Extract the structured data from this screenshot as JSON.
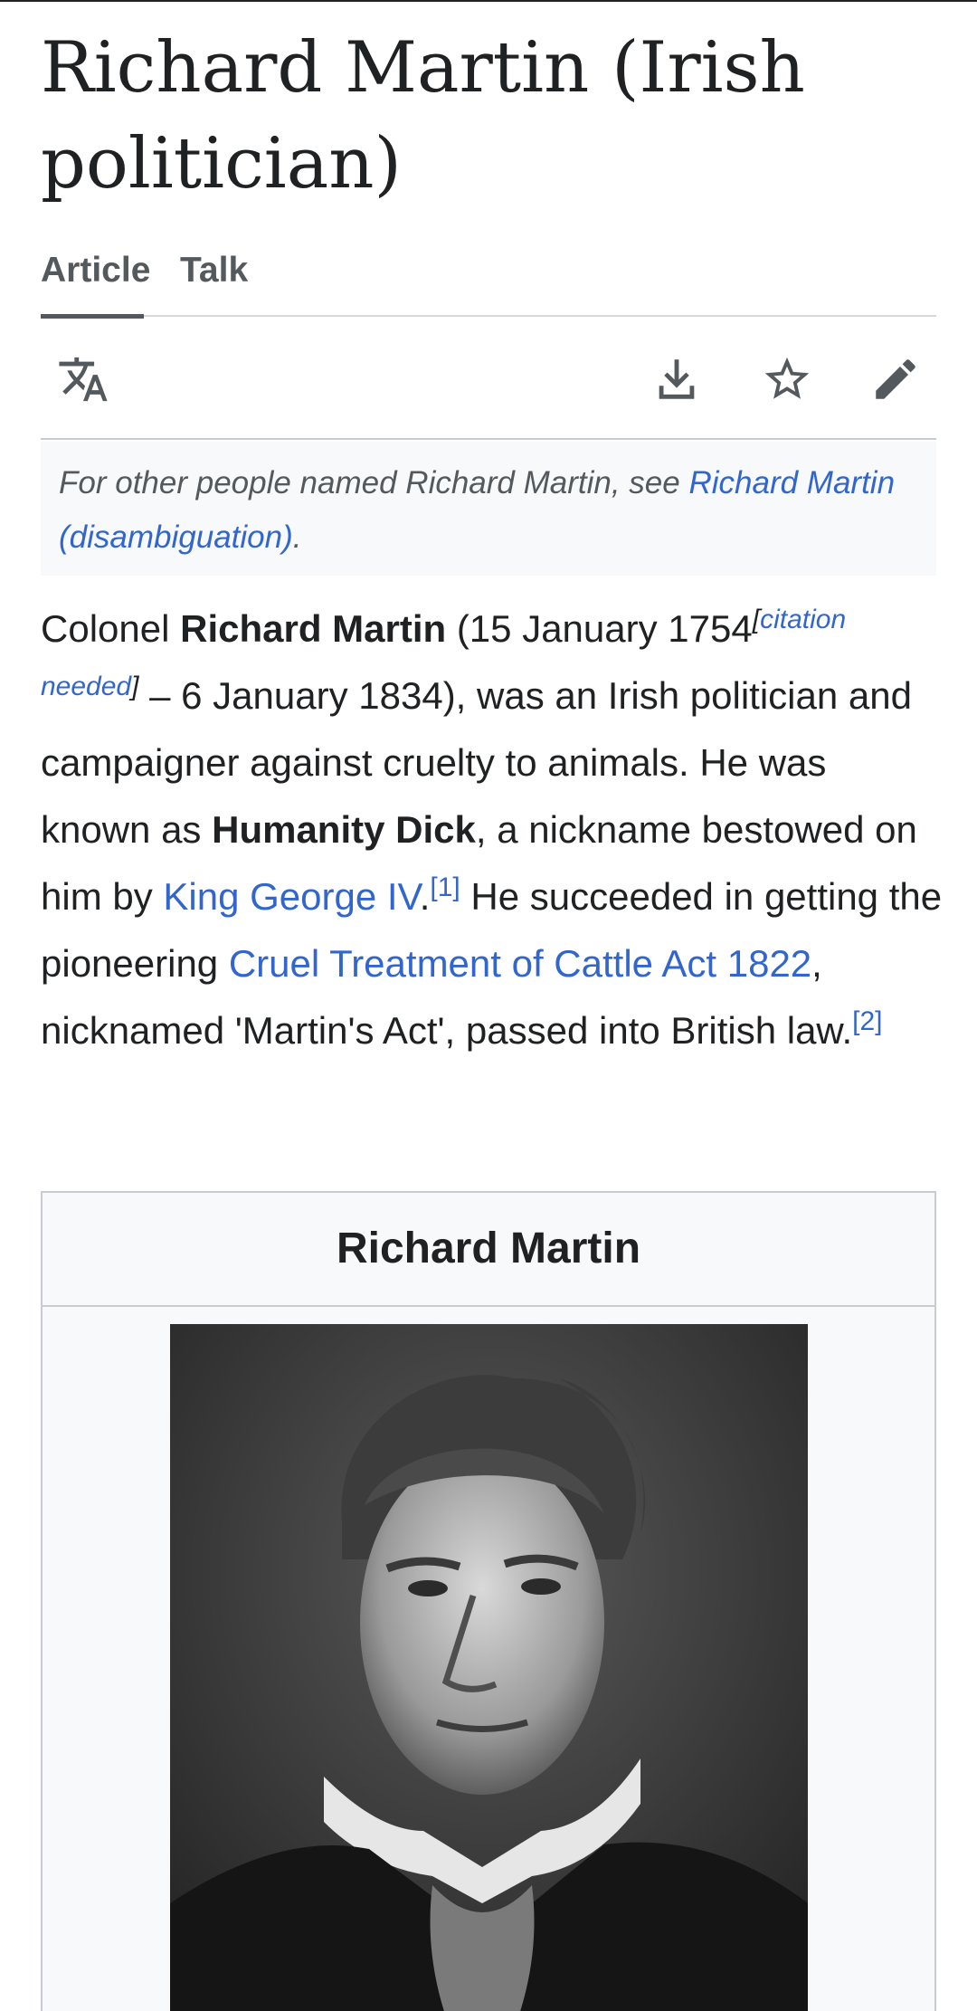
{
  "page": {
    "title": "Richard Martin (Irish politician)"
  },
  "tabs": [
    {
      "label": "Article",
      "active": true
    },
    {
      "label": "Talk",
      "active": false
    }
  ],
  "actions": {
    "language_icon": "language-translate-icon",
    "download_icon": "download-icon",
    "watch_icon": "star-icon",
    "edit_icon": "pencil-edit-icon"
  },
  "hatnote": {
    "text": "For other people named Richard Martin, see ",
    "link": "Richard Martin (disambiguation)",
    "end": "."
  },
  "lead": {
    "t1": "Colonel ",
    "name": "Richard Martin",
    "t2": " (15 January 1754",
    "cite_open": "[",
    "cite_needed": "citation needed",
    "cite_close": "]",
    "t3": " – 6 January 1834), was an Irish politician and campaigner against cruelty to animals. He was known as ",
    "nickname": "Humanity Dick",
    "t4": ", a nickname bestowed on him by ",
    "link_king": "King George IV",
    "t5": ".",
    "ref1": "[1]",
    "t6": " He succeeded in getting the pioneering ",
    "link_act": "Cruel Treatment of Cattle Act 1822",
    "t7": ", nicknamed 'Martin's Act', passed into British law.",
    "ref2": "[2]"
  },
  "infobox": {
    "title": "Richard Martin",
    "image_subject": "portrait-image"
  },
  "colors": {
    "link": "#3366cc",
    "text": "#202122",
    "muted": "#54595d",
    "border": "#c8ccd1",
    "panel": "#f8f9fa"
  }
}
